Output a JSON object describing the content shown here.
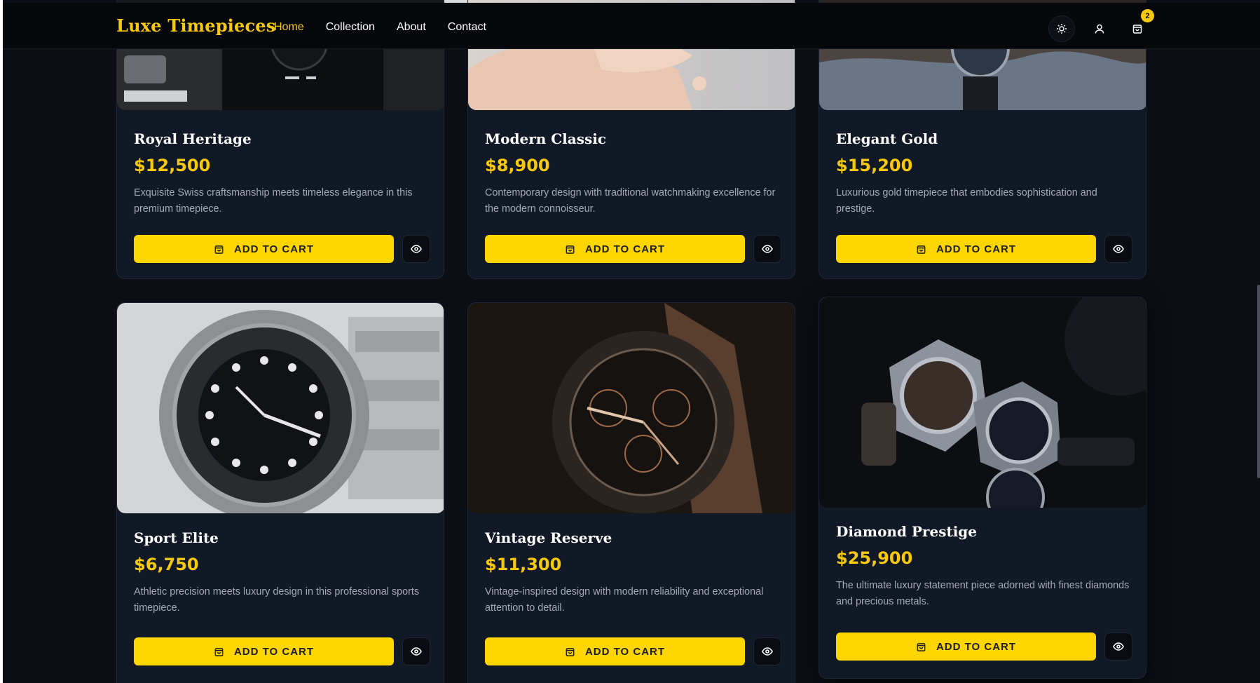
{
  "app": {
    "brand": "Luxe Timepieces",
    "nav": [
      "Home",
      "Collection",
      "About",
      "Contact"
    ],
    "active_nav": "Home",
    "cart_count": "2",
    "icons": {
      "theme": "sun-icon",
      "user": "user-icon",
      "cart": "shopping-bag-icon"
    }
  },
  "products": [
    {
      "name": "Royal Heritage",
      "price": "$12,500",
      "description": "Exquisite Swiss craftsmanship meets timeless elegance in this premium timepiece.",
      "cta": "ADD TO CART"
    },
    {
      "name": "Modern Classic",
      "price": "$8,900",
      "description": "Contemporary design with traditional watchmaking excellence for the modern connoisseur.",
      "cta": "ADD TO CART"
    },
    {
      "name": "Elegant Gold",
      "price": "$15,200",
      "description": "Luxurious gold timepiece that embodies sophistication and prestige.",
      "cta": "ADD TO CART"
    },
    {
      "name": "Sport Elite",
      "price": "$6,750",
      "description": "Athletic precision meets luxury design in this professional sports timepiece.",
      "cta": "ADD TO CART"
    },
    {
      "name": "Vintage Reserve",
      "price": "$11,300",
      "description": "Vintage-inspired design with modern reliability and exceptional attention to detail.",
      "cta": "ADD TO CART"
    },
    {
      "name": "Diamond Prestige",
      "price": "$25,900",
      "description": "The ultimate luxury statement piece adorned with finest diamonds and precious metals.",
      "cta": "ADD TO CART"
    }
  ],
  "colors": {
    "accent": "#f6c90e",
    "button": "#fdd600",
    "background": "#0b0e14",
    "card": "#111826"
  }
}
